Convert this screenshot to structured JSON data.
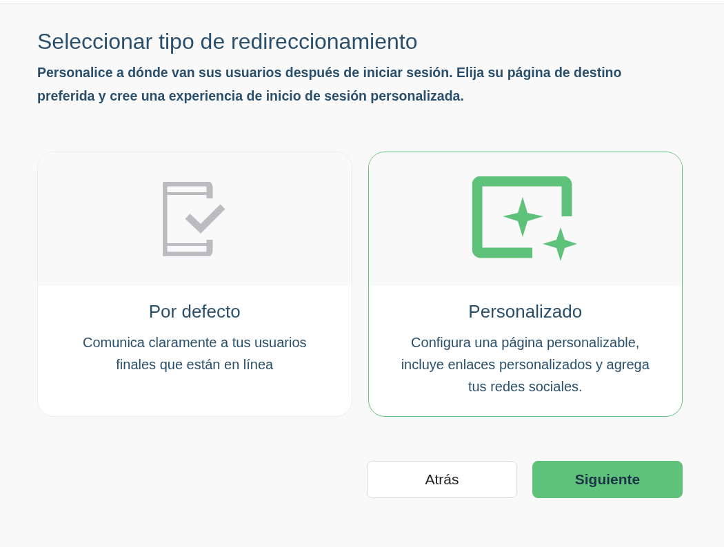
{
  "title": "Seleccionar tipo de redireccionamiento",
  "subtitle": "Personalice a dónde van sus usuarios después de iniciar sesión. Elija su página de destino preferida y cree una experiencia de inicio de sesión personalizada.",
  "options": [
    {
      "kind": "default",
      "title": "Por defecto",
      "description": "Comunica claramente a tus usuarios finales que están en línea",
      "selected": false
    },
    {
      "kind": "custom",
      "title": "Personalizado",
      "description": "Configura una página personalizable, incluye enlaces personalizados y agrega tus redes sociales.",
      "selected": true
    }
  ],
  "buttons": [
    {
      "kind": "secondary",
      "label": "Atrás"
    },
    {
      "kind": "primary",
      "label": "Siguiente"
    }
  ]
}
